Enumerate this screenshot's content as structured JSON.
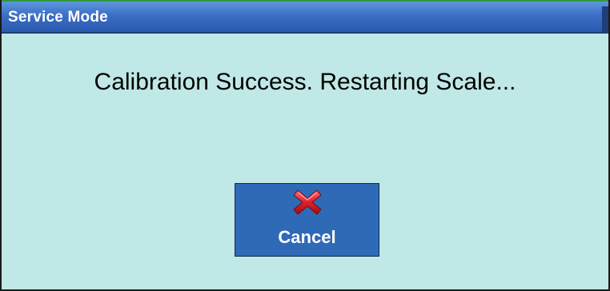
{
  "window": {
    "title": "Service Mode"
  },
  "dialog": {
    "message": "Calibration Success. Restarting Scale..."
  },
  "cancel_button": {
    "label": "Cancel",
    "icon": "red-x-icon"
  },
  "colors": {
    "background": "#bfe8e6",
    "titlebar": "#3a6fc4",
    "button": "#2f6ab7",
    "icon": "#d2202f"
  }
}
